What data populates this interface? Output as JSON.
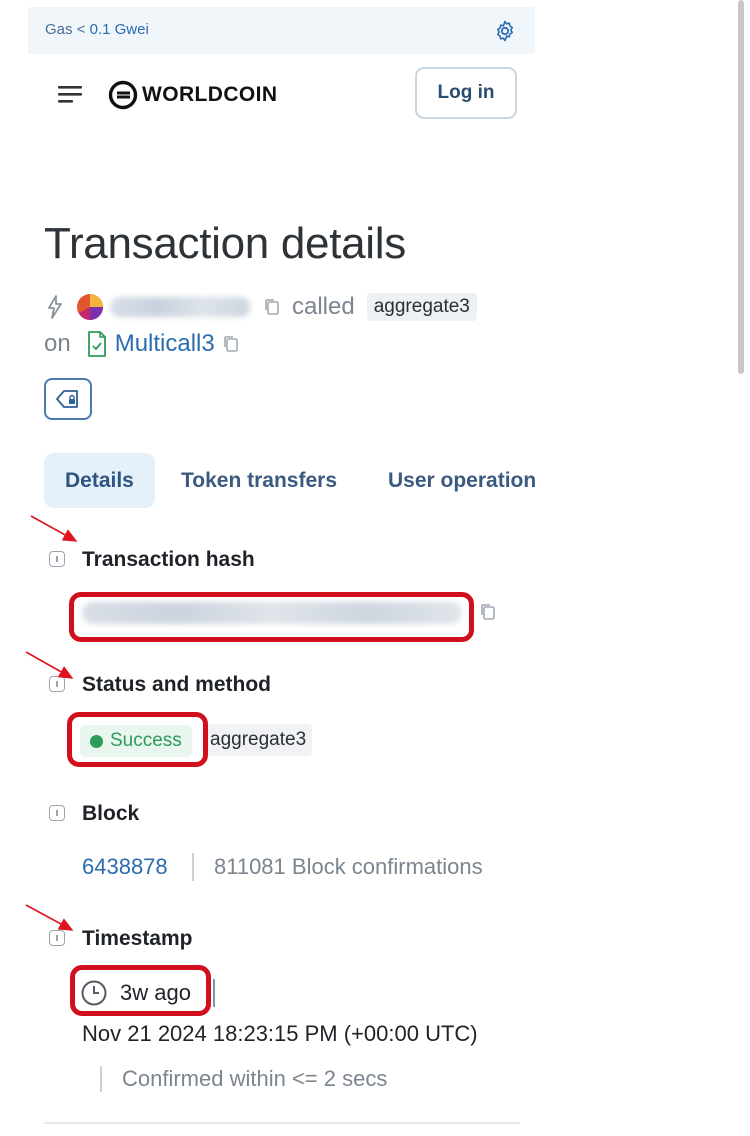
{
  "gas": {
    "label": "Gas",
    "lt": "<",
    "value": "0.1 Gwei"
  },
  "brand": {
    "name": "WORLDCOIN"
  },
  "header": {
    "login": "Log in"
  },
  "title": "Transaction details",
  "summary": {
    "called": "called",
    "method": "aggregate3",
    "on": "on",
    "contract": "Multicall3"
  },
  "tabs": [
    "Details",
    "Token transfers",
    "User operations"
  ],
  "fields": {
    "tx_hash": {
      "label": "Transaction hash"
    },
    "status": {
      "label": "Status and method",
      "status": "Success",
      "method": "aggregate3"
    },
    "block": {
      "label": "Block",
      "number": "6438878",
      "confirmations": "811081 Block confirmations"
    },
    "timestamp": {
      "label": "Timestamp",
      "ago": "3w ago",
      "datetime": "Nov 21 2024 18:23:15 PM (+00:00 UTC)",
      "confirmed": "Confirmed within <= 2 secs"
    }
  },
  "colors": {
    "link": "#2b6cb0",
    "success": "#2c9a5a",
    "highlight": "#d0101c"
  }
}
